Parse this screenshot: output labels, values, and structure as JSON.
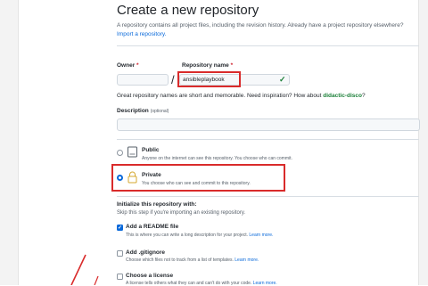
{
  "page": {
    "title": "Create a new repository",
    "subtitle": "A repository contains all project files, including the revision history. Already have a project repository elsewhere?",
    "import_link": "Import a repository."
  },
  "owner": {
    "label": "Owner",
    "required": "*"
  },
  "repo": {
    "label": "Repository name",
    "required": "*",
    "value": "ansibleplaybook",
    "valid_mark": "✓",
    "slash": "/"
  },
  "name_hint": {
    "prefix": "Great repository names are short and memorable. Need inspiration? How about",
    "suggestion": "didactic-disco",
    "suffix": "?"
  },
  "description": {
    "label": "Description",
    "optional": "(optional)"
  },
  "visibility": {
    "public_label": "Public",
    "public_desc": "Anyone on the internet can see this repository. You choose who can commit.",
    "private_label": "Private",
    "private_desc": "You choose who can see and commit to this repository.",
    "selected": "private"
  },
  "init": {
    "heading": "Initialize this repository with:",
    "skip_note": "Skip this step if you're importing an existing repository.",
    "readme_label": "Add a README file",
    "readme_desc": "This is where you can write a long description for your project.",
    "readme_checked": true,
    "gitignore_label": "Add .gitignore",
    "gitignore_desc": "Choose which files not to track from a list of templates.",
    "gitignore_checked": false,
    "license_label": "Choose a license",
    "license_desc": "A license tells others what they can and can't do with your code.",
    "license_checked": false,
    "learn_more": "Learn more."
  },
  "colors": {
    "accent": "#0969da",
    "success": "#1a7f37",
    "highlight": "#d92b2b"
  }
}
